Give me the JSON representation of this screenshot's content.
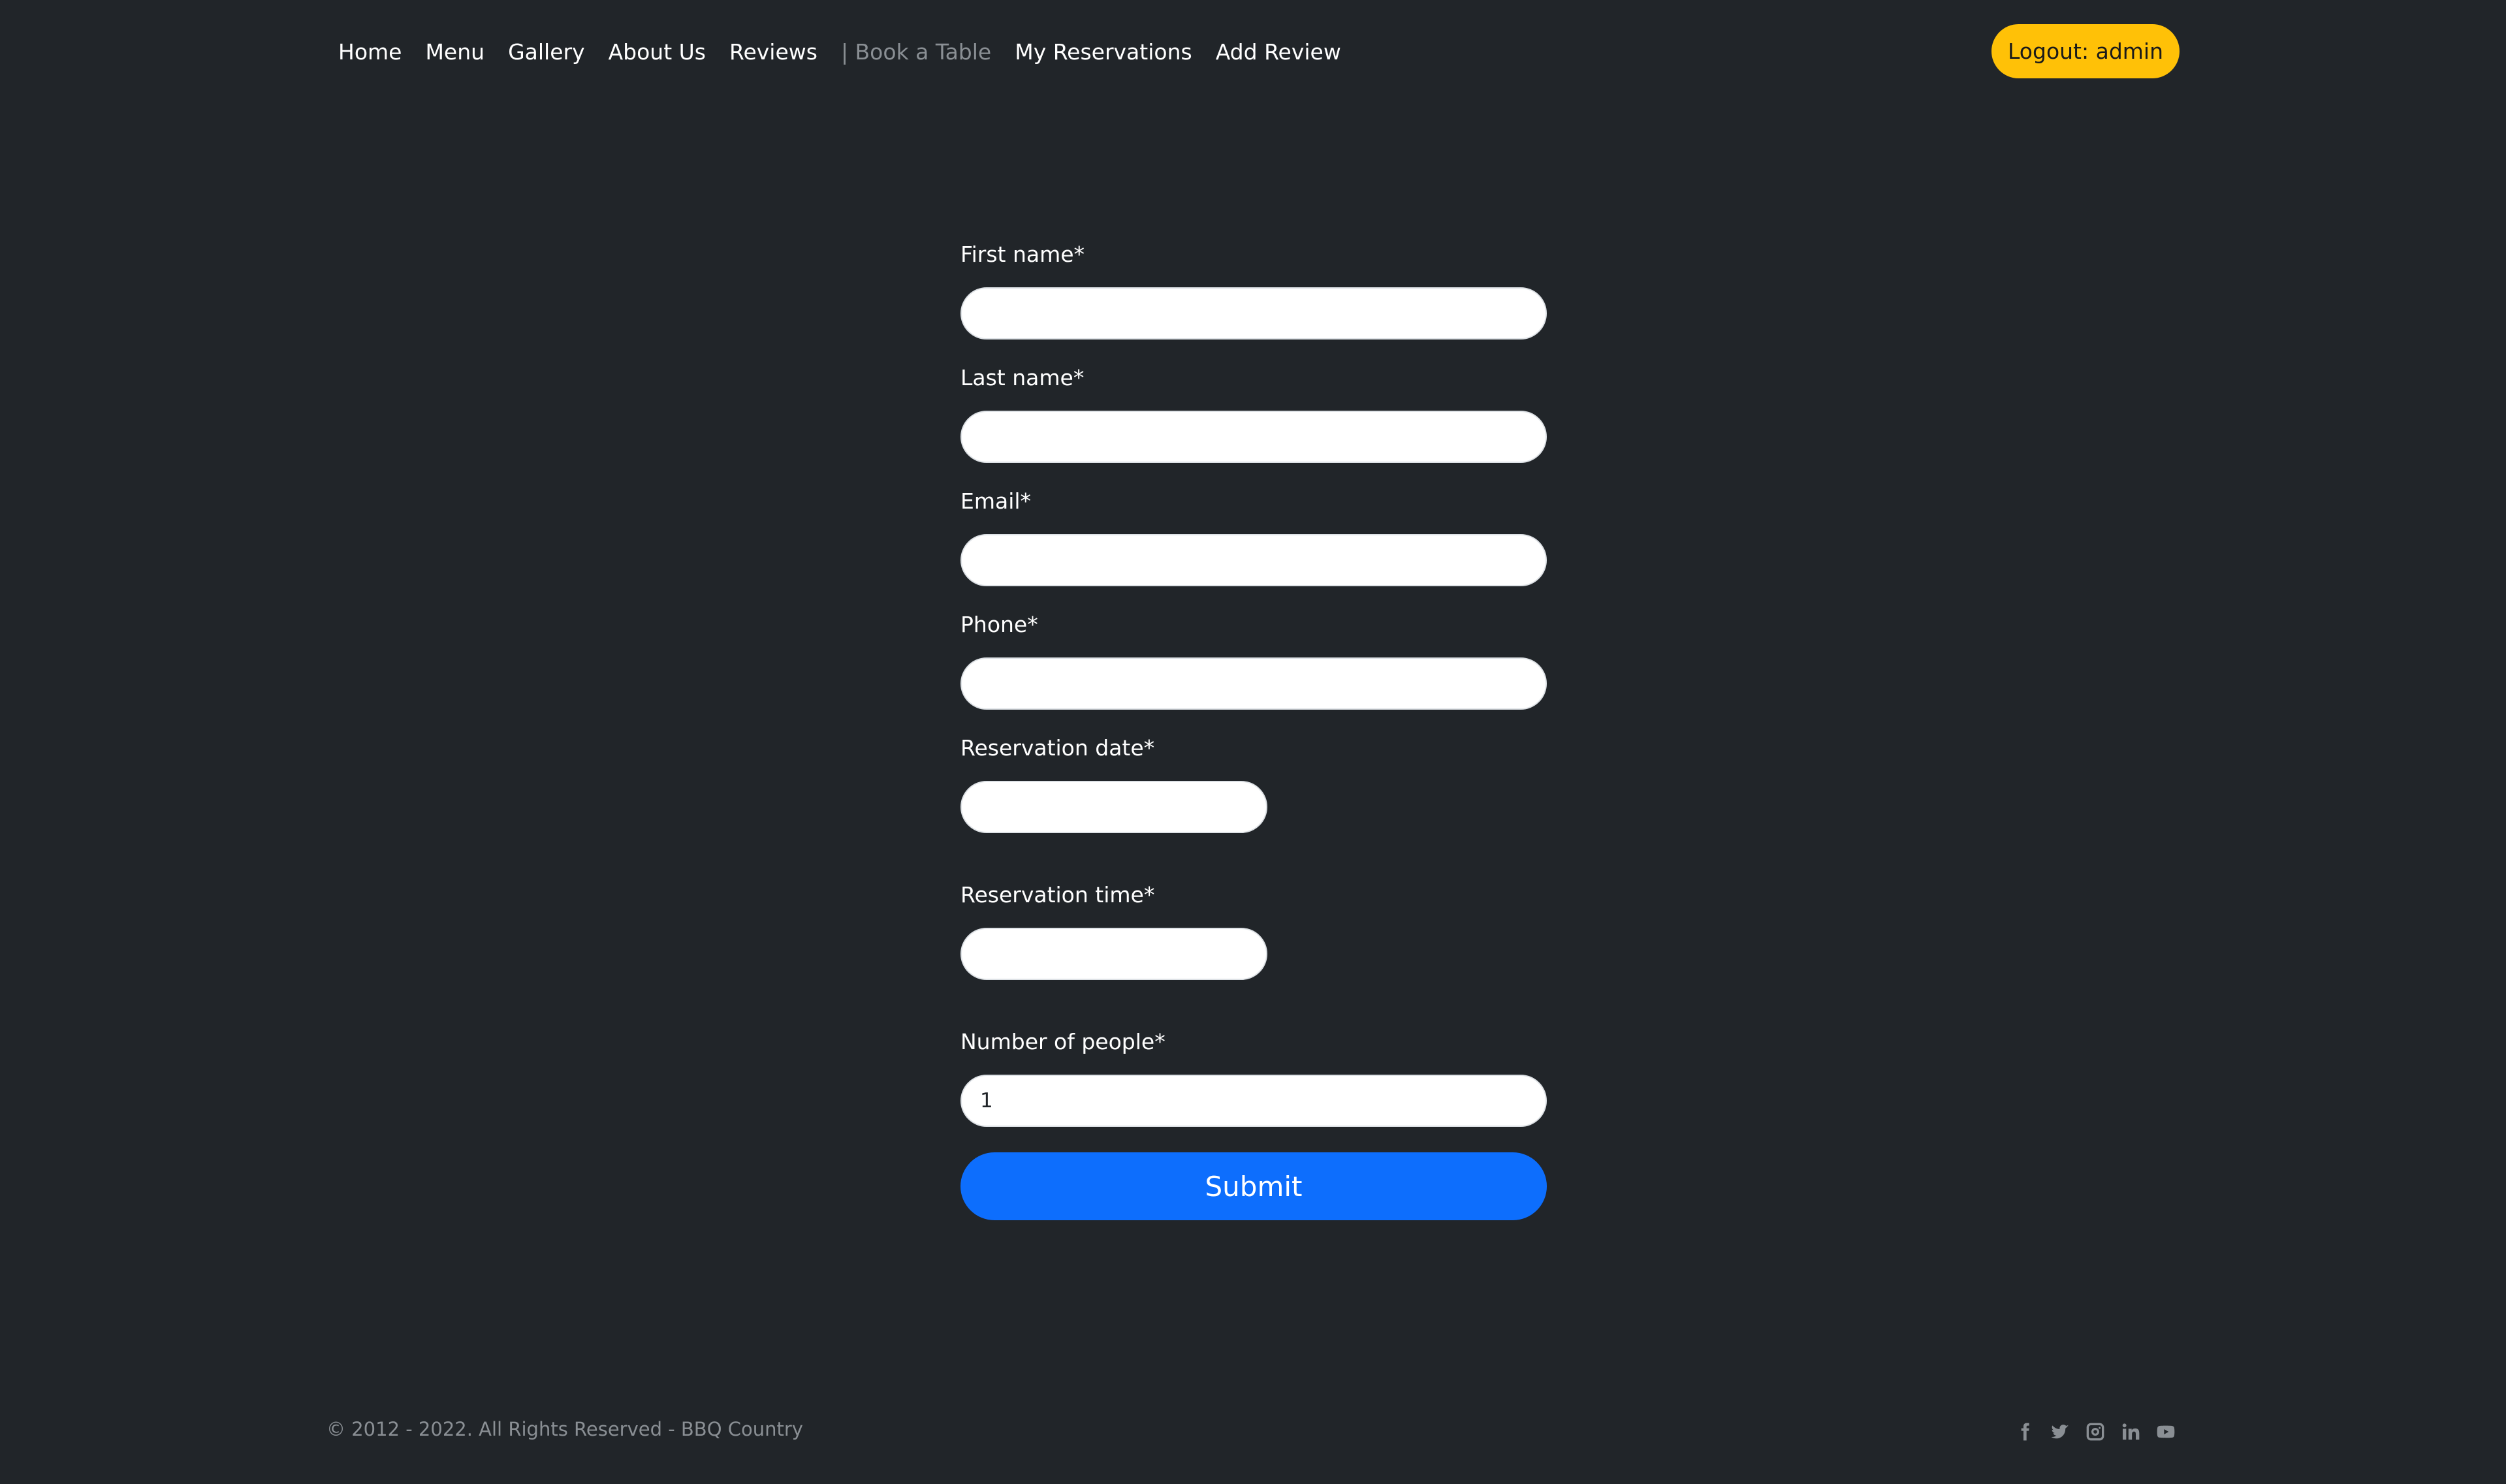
{
  "nav": {
    "links": [
      {
        "label": "Home"
      },
      {
        "label": "Menu"
      },
      {
        "label": "Gallery"
      },
      {
        "label": "About Us"
      },
      {
        "label": "Reviews"
      },
      {
        "label": "| Book a Table"
      },
      {
        "label": "My Reservations"
      },
      {
        "label": "Add Review"
      }
    ],
    "active_index": 5,
    "logout_label": "Logout: admin"
  },
  "form": {
    "first_name": {
      "label": "First name*",
      "value": ""
    },
    "last_name": {
      "label": "Last name*",
      "value": ""
    },
    "email": {
      "label": "Email*",
      "value": ""
    },
    "phone": {
      "label": "Phone*",
      "value": ""
    },
    "reservation_date": {
      "label": "Reservation date*",
      "value": ""
    },
    "reservation_time": {
      "label": "Reservation time*",
      "value": ""
    },
    "people": {
      "label": "Number of people*",
      "value": "1"
    },
    "submit_label": "Submit"
  },
  "footer": {
    "copyright": "© 2012 - 2022. All Rights Reserved - BBQ Country",
    "social_icons": [
      "facebook-icon",
      "twitter-icon",
      "instagram-icon",
      "linkedin-icon",
      "youtube-icon"
    ]
  },
  "colors": {
    "background": "#212529",
    "accent_logout": "#ffc107",
    "submit": "#0d6efd",
    "muted": "#8a8f94"
  }
}
